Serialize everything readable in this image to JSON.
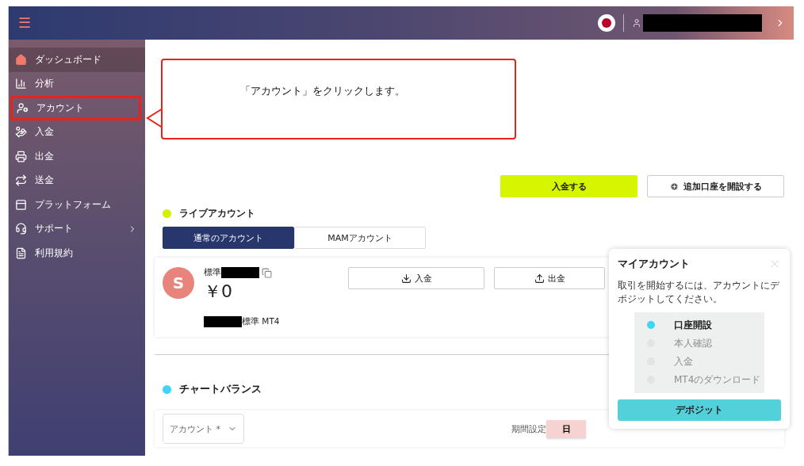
{
  "header": {
    "menu_icon": "☰"
  },
  "sidebar": {
    "items": [
      {
        "label": "ダッシュボード",
        "selected": true,
        "highlighted": false,
        "has_submenu": false
      },
      {
        "label": "分析",
        "selected": false,
        "highlighted": false,
        "has_submenu": false
      },
      {
        "label": "アカウント",
        "selected": false,
        "highlighted": true,
        "has_submenu": false
      },
      {
        "label": "入金",
        "selected": false,
        "highlighted": false,
        "has_submenu": false
      },
      {
        "label": "出金",
        "selected": false,
        "highlighted": false,
        "has_submenu": false
      },
      {
        "label": "送金",
        "selected": false,
        "highlighted": false,
        "has_submenu": false
      },
      {
        "label": "プラットフォーム",
        "selected": false,
        "highlighted": false,
        "has_submenu": false
      },
      {
        "label": "サポート",
        "selected": false,
        "highlighted": false,
        "has_submenu": true
      },
      {
        "label": "利用規約",
        "selected": false,
        "highlighted": false,
        "has_submenu": false
      }
    ]
  },
  "callout": {
    "text": "「アカウント」をクリックします。"
  },
  "actions": [
    {
      "label": "入金する",
      "kind": "primary"
    },
    {
      "label": "追加口座を開設する",
      "kind": "add"
    }
  ],
  "live_section": {
    "title": "ライブアカウント",
    "color": "#d4f000",
    "tabs": [
      {
        "label": "通常のアカウント",
        "selected": true
      },
      {
        "label": "MAMアカウント",
        "selected": false
      }
    ],
    "account": {
      "avatar": "S",
      "name": "標準",
      "balance": "￥0",
      "platform": "標準 MT4",
      "buttons": [
        {
          "label": "入金",
          "kind": "download"
        },
        {
          "label": "出金",
          "kind": "upload"
        }
      ]
    }
  },
  "chart_section": {
    "title": "チャートバランス",
    "color": "#3fd6f5",
    "account_field": {
      "placeholder": "アカウント *"
    },
    "period_label": "期間設定",
    "periods": [
      {
        "label": "日",
        "selected": true
      }
    ]
  },
  "popover": {
    "title": "マイアカウント",
    "message": "取引を開始するには、アカウントにデポジットしてください。",
    "steps": [
      {
        "label": "口座開設",
        "active": true
      },
      {
        "label": "本人確認",
        "active": false
      },
      {
        "label": "入金",
        "active": false
      },
      {
        "label": "MT4のダウンロード",
        "active": false
      }
    ],
    "button": "デポジット"
  }
}
